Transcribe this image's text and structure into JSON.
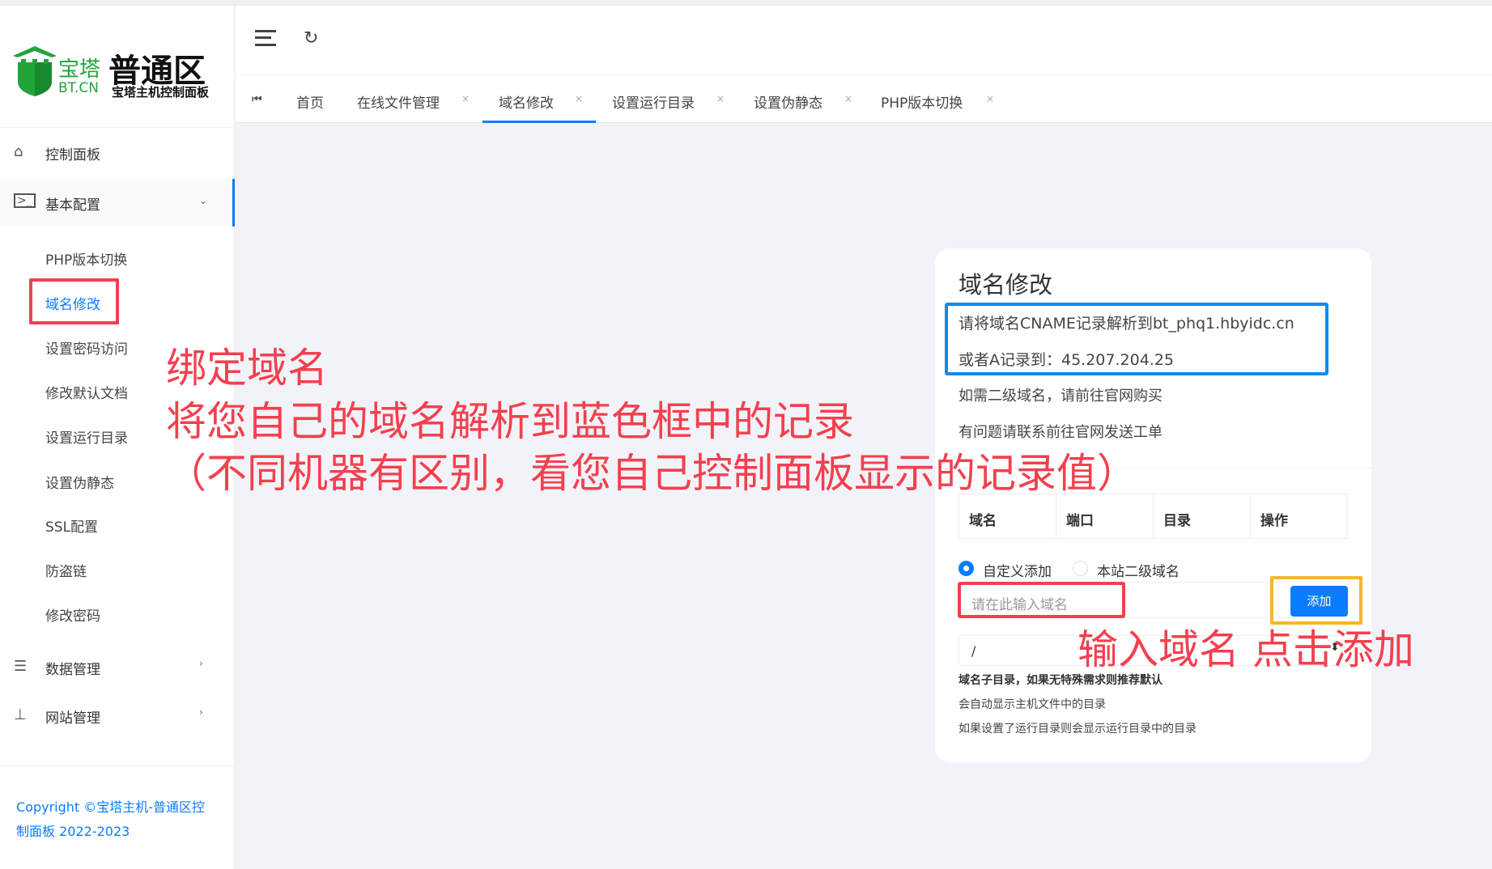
{
  "logo": {
    "brand_cn": "宝塔",
    "brand_en": "BT.CN",
    "title": "普通区",
    "subtitle": "宝塔主机控制面板"
  },
  "sidebar": {
    "items": [
      {
        "label": "控制面板",
        "icon": "home-icon"
      },
      {
        "label": "基本配置",
        "icon": "terminal-icon"
      },
      {
        "label": "数据管理",
        "icon": "list-icon"
      },
      {
        "label": "网站管理",
        "icon": "sitemap-icon"
      }
    ],
    "subitems": [
      "PHP版本切换",
      "域名修改",
      "设置密码访问",
      "修改默认文档",
      "设置运行目录",
      "设置伪静态",
      "SSL配置",
      "防盗链",
      "修改密码"
    ],
    "copyright_1": "Copyright ©宝塔主机-普通区控",
    "copyright_2": "制面板 2022-2023"
  },
  "tabs": [
    {
      "label": "首页"
    },
    {
      "label": "在线文件管理"
    },
    {
      "label": "域名修改",
      "active": true
    },
    {
      "label": "设置运行目录"
    },
    {
      "label": "设置伪静态"
    },
    {
      "label": "PHP版本切换"
    }
  ],
  "card": {
    "title": "域名修改",
    "cname": "请将域名CNAME记录解析到bt_phq1.hbyidc.cn",
    "arecord": "或者A记录到：45.207.204.25",
    "tip1": "如需二级域名，请前往官网购买",
    "tip2": "有问题请联系前往官网发送工单",
    "table_headers": [
      "域名",
      "端口",
      "目录",
      "操作"
    ],
    "radio_custom": "自定义添加",
    "radio_sub": "本站二级域名",
    "domain_placeholder": "请在此输入域名",
    "add_button": "添加",
    "dir_value": "/",
    "help_bold": "域名子目录，如果无特殊需求则推荐默认",
    "help1": "会自动显示主机文件中的目录",
    "help2": "如果设置了运行目录则会显示运行目录中的目录"
  },
  "annotations": {
    "a1": "绑定域名",
    "a2": "将您自己的域名解析到蓝色框中的记录",
    "a3": "（不同机器有区别，看您自己控制面板显示的记录值）",
    "a4": "输入域名 点击添加"
  },
  "colors": {
    "accent": "#0a7cff",
    "annotation": "#f2404f",
    "blue_box": "#0a8cf0",
    "orange_box": "#f8b62b",
    "green": "#20a53a"
  }
}
